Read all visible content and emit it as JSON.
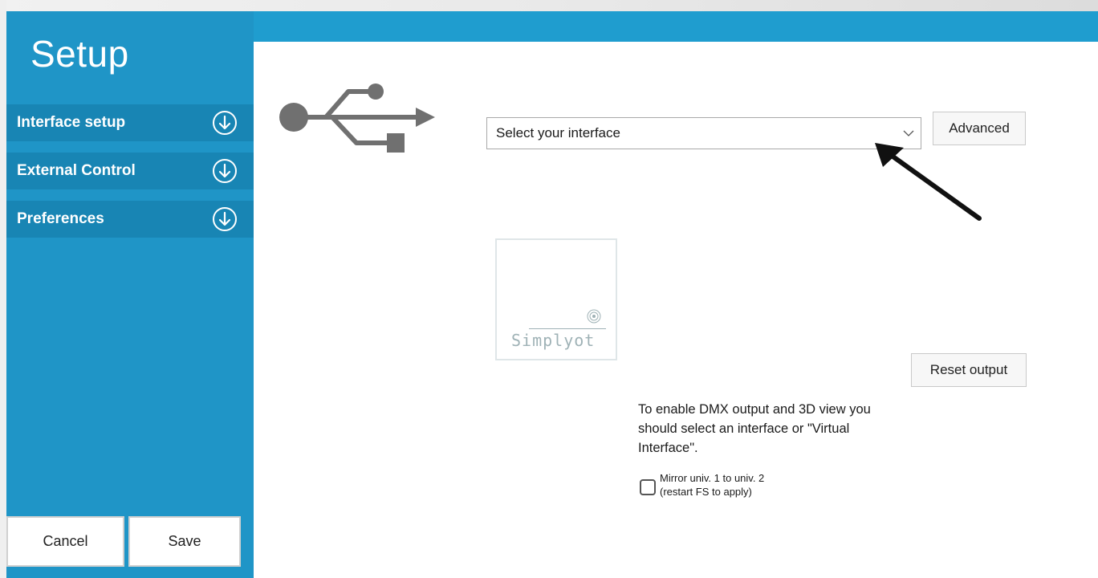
{
  "window": {
    "title": "Setup"
  },
  "sidebar": {
    "title": "Setup",
    "items": [
      {
        "label": "Interface setup",
        "icon": "expand-down-icon"
      },
      {
        "label": "External Control",
        "icon": "expand-down-icon"
      },
      {
        "label": "Preferences",
        "icon": "expand-down-icon"
      }
    ],
    "cancel_label": "Cancel",
    "save_label": "Save"
  },
  "main": {
    "usb_icon": "usb-icon",
    "interface_select": {
      "value": "Select your interface",
      "icon": "chevron-down-icon"
    },
    "advanced_label": "Advanced",
    "annotation": "arrow-pointer-icon",
    "logo": {
      "text": "Simplyot",
      "icon": "signal-icon"
    },
    "reset_label": "Reset output",
    "info_text": "To enable DMX output and 3D view you should select an interface or \"Virtual Interface\".",
    "mirror": {
      "line1": "Mirror univ. 1 to univ. 2",
      "line2": "(restart FS to apply)",
      "checked": false
    }
  },
  "colors": {
    "sidebar_bg": "#1f95c7",
    "sidebar_item_bg": "#1885b4",
    "topbar_bg": "#1f9dcf",
    "icon_gray": "#707070"
  }
}
